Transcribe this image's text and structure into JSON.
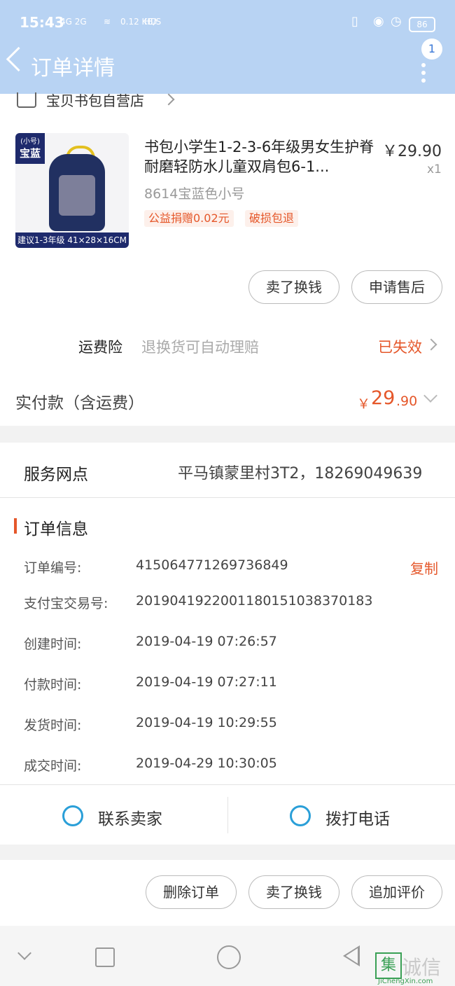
{
  "status_bar": {
    "time": "15:43",
    "network": "4G 2G",
    "speed": "0.12 KB/S",
    "hd": "HD",
    "icons": [
      "vibrate-icon",
      "lock-icon",
      "alarm-icon"
    ],
    "battery": "86"
  },
  "header": {
    "title": "订单详情",
    "badge": "1",
    "colors": {
      "background": "#b8d3f3",
      "text": "#ffffff"
    }
  },
  "shop": {
    "name": "宝贝书包自营店"
  },
  "product": {
    "thumb_tag_small": "(小号)",
    "thumb_tag_big": "宝蓝",
    "thumb_caption": "建议1-3年级 41×28×16CM",
    "title": "书包小学生1-2-3-6年级男女生护脊耐磨轻防水儿童双肩包6-1...",
    "price": "￥29.90",
    "qty": "x1",
    "sku": "8614宝蓝色小号",
    "tags": [
      "公益捐赠0.02元",
      "破损包退"
    ]
  },
  "item_buttons": {
    "sell": "卖了换钱",
    "aftersale": "申请售后"
  },
  "insurance": {
    "label": "运费险",
    "desc": "退换货可自动理赔",
    "status": "已失效"
  },
  "payment": {
    "label": "实付款（含运费）",
    "symbol": "￥",
    "amount_int": "29",
    "amount_dec": ".90"
  },
  "service_point": {
    "label": "服务网点",
    "value": "平马镇蒙里村3T2，18269049639"
  },
  "order_info": {
    "title": "订单信息",
    "copy": "复制",
    "rows": [
      {
        "label": "订单编号:",
        "value": "415064771269736849"
      },
      {
        "label": "支付宝交易号:",
        "value": "2019041922001180151038370183"
      },
      {
        "label": "创建时间:",
        "value": "2019-04-19 07:26:57"
      },
      {
        "label": "付款时间:",
        "value": "2019-04-19 07:27:11"
      },
      {
        "label": "发货时间:",
        "value": "2019-04-19 10:29:55"
      },
      {
        "label": "成交时间:",
        "value": "2019-04-29 10:30:05"
      }
    ]
  },
  "actions": {
    "contact": "联系卖家",
    "call": "拨打电话"
  },
  "bottom_buttons": {
    "delete": "删除订单",
    "sell": "卖了换钱",
    "review": "追加评价"
  },
  "watermark": {
    "mark": "集",
    "text": "诚信",
    "url": "JiChengXin.com"
  },
  "accent_color": "#e5572a"
}
